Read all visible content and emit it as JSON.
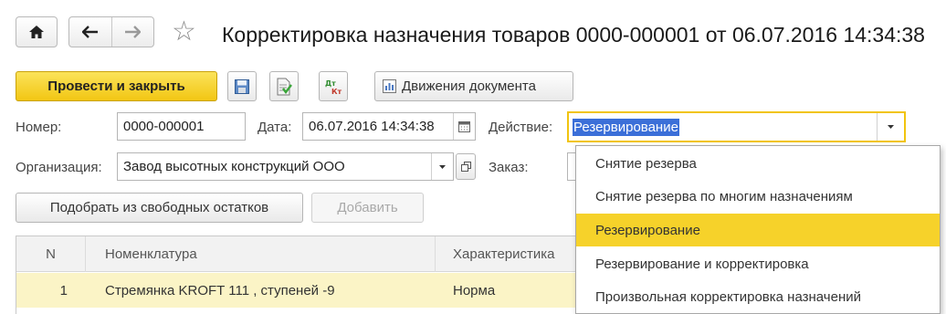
{
  "window": {
    "title": "Корректировка назначения товаров 0000-000001 от 06.07.2016 14:34:38"
  },
  "toolbar": {
    "post_close_label": "Провести и закрыть",
    "movements_label": "Движения документа"
  },
  "form": {
    "number_label": "Номер:",
    "number_value": "0000-000001",
    "date_label": "Дата:",
    "date_value": "06.07.2016 14:34:38",
    "action_label": "Действие:",
    "action_value": "Резервирование",
    "organization_label": "Организация:",
    "organization_value": "Завод высотных конструкций ООО",
    "order_label": "Заказ:"
  },
  "action_dropdown": {
    "options": [
      "Снятие резерва",
      "Снятие резерва по многим назначениям",
      "Резервирование",
      "Резервирование и корректировка",
      "Произвольная корректировка назначений"
    ],
    "selected_index": 2
  },
  "buttons": {
    "pick_label": "Подобрать из свободных остатков",
    "add_label": "Добавить"
  },
  "table": {
    "columns": [
      "N",
      "Номенклатура",
      "Характеристика"
    ],
    "rows": [
      {
        "n": "1",
        "item": "Стремянка KROFT 111 , ступеней -9",
        "characteristic": "Норма"
      }
    ]
  },
  "colors": {
    "primary_yellow": "#f2c613",
    "selection_blue": "#3b6fd8",
    "row_highlight": "#fbf4c6"
  }
}
